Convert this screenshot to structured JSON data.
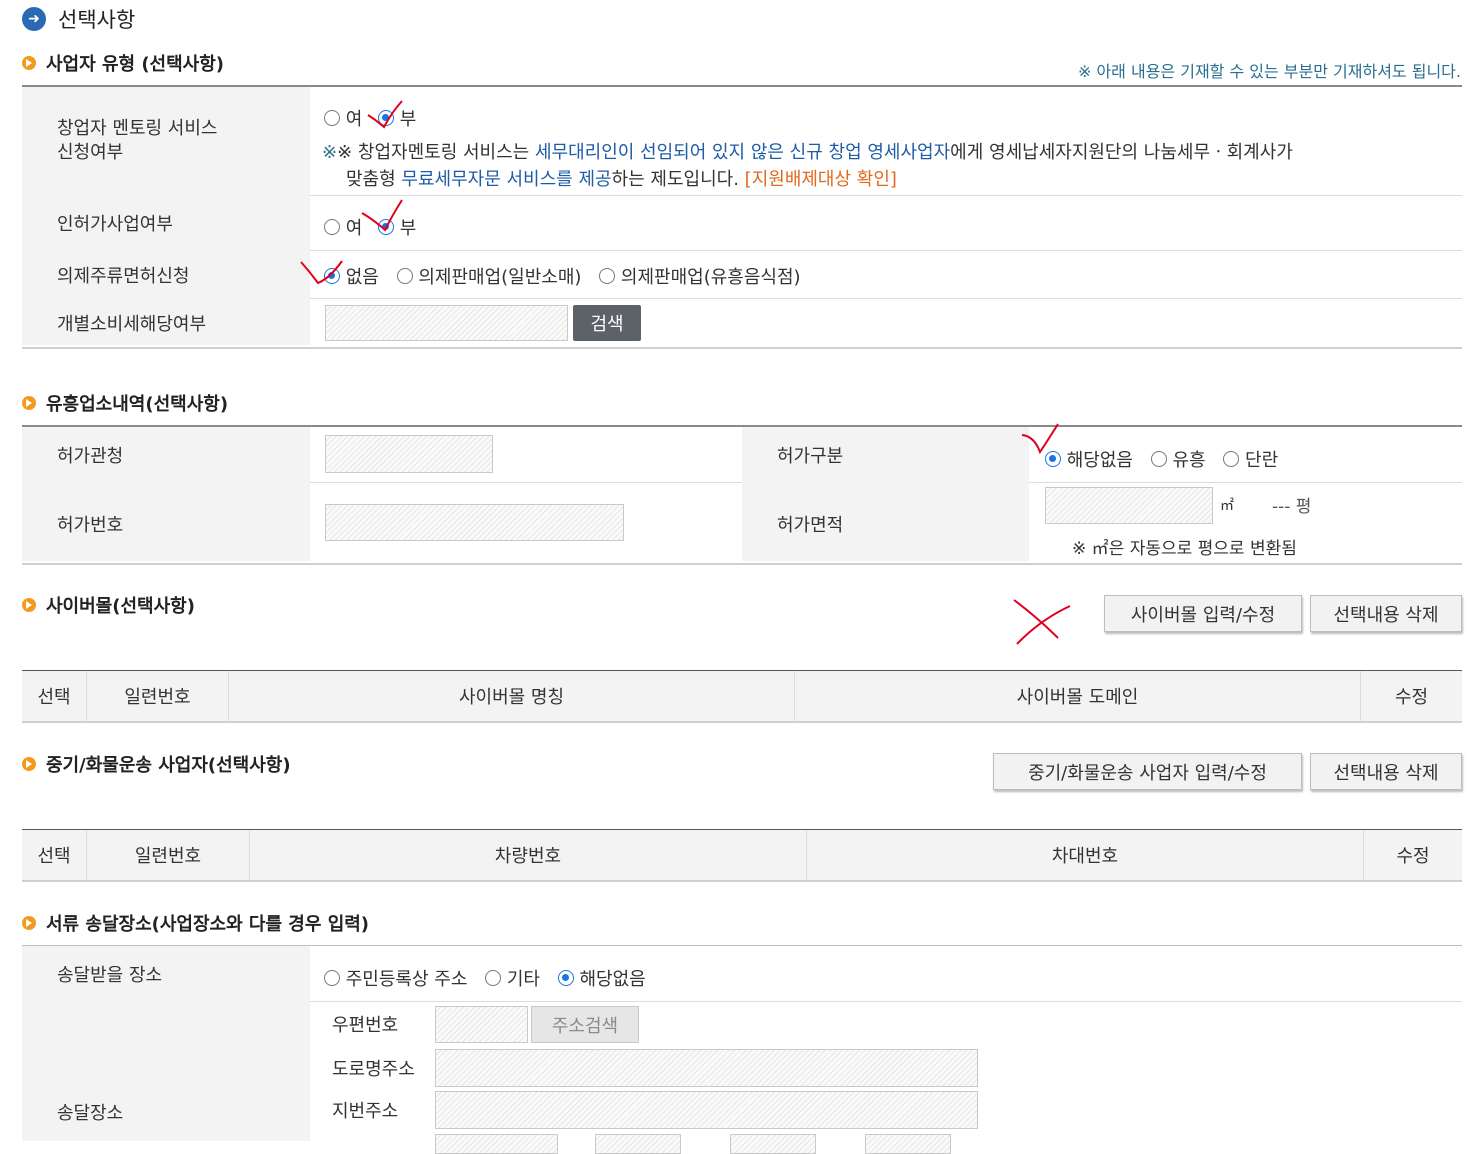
{
  "page_title": "선택사항",
  "business_type": {
    "title": "사업자 유형 (선택사항)",
    "note": "※ 아래 내용은 기재할 수 있는 부분만 기재하셔도 됩니다.",
    "mentoring": {
      "label": "창업자 멘토링 서비스\n신청여부",
      "options": [
        "여",
        "부"
      ],
      "selected": "부",
      "desc_prefix": "※ 창업자멘토링 서비스는 ",
      "desc_blue1": "세무대리인이 선임되어 있지 않은 신규 창업 영세사업자",
      "desc_mid": "에게 영세납세자지원단의 나눔세무ㆍ회계사가",
      "desc_line2_prefix": "맞춤형 ",
      "desc_blue2": "무료세무자문 서비스를 제공",
      "desc_line2_mid": "하는 제도입니다. ",
      "desc_link": "[지원배제대상 확인]"
    },
    "license_business": {
      "label": "인허가사업여부",
      "options": [
        "여",
        "부"
      ],
      "selected": "부"
    },
    "liquor_license": {
      "label": "의제주류면허신청",
      "options": [
        "없음",
        "의제판매업(일반소매)",
        "의제판매업(유흥음식점)"
      ],
      "selected": "없음"
    },
    "excise_tax": {
      "label": "개별소비세해당여부",
      "input_value": "",
      "search_button": "검색"
    }
  },
  "entertainment": {
    "title": "유흥업소내역(선택사항)",
    "permit_office_label": "허가관청",
    "permit_type_label": "허가구분",
    "permit_type_options": [
      "해당없음",
      "유흥",
      "단란"
    ],
    "permit_type_selected": "해당없음",
    "permit_number_label": "허가번호",
    "permit_area_label": "허가면적",
    "area_unit": "㎡",
    "pyeong_text": "--- 평",
    "area_note": "※ ㎡은 자동으로 평으로 변환됨"
  },
  "cyber_mall": {
    "title": "사이버몰(선택사항)",
    "input_button": "사이버몰 입력/수정",
    "delete_button": "선택내용 삭제",
    "columns": [
      "선택",
      "일련번호",
      "사이버몰 명칭",
      "사이버몰 도메인",
      "수정"
    ]
  },
  "transport": {
    "title": "중기/화물운송 사업자(선택사항)",
    "input_button": "중기/화물운송 사업자 입력/수정",
    "delete_button": "선택내용 삭제",
    "columns": [
      "선택",
      "일련번호",
      "차량번호",
      "차대번호",
      "수정"
    ]
  },
  "delivery": {
    "title": "서류 송달장소(사업장소와 다를 경우 입력)",
    "receive_label": "송달받을 장소",
    "receive_options": [
      "주민등록상 주소",
      "기타",
      "해당없음"
    ],
    "receive_selected": "해당없음",
    "place_label": "송달장소",
    "postal_label": "우편번호",
    "address_search": "주소검색",
    "road_label": "도로명주소",
    "lot_label": "지번주소"
  },
  "colors": {
    "accent_blue": "#1a73e8",
    "bullet_orange": "#f39a1e",
    "annotation_red": "#e0001a"
  }
}
